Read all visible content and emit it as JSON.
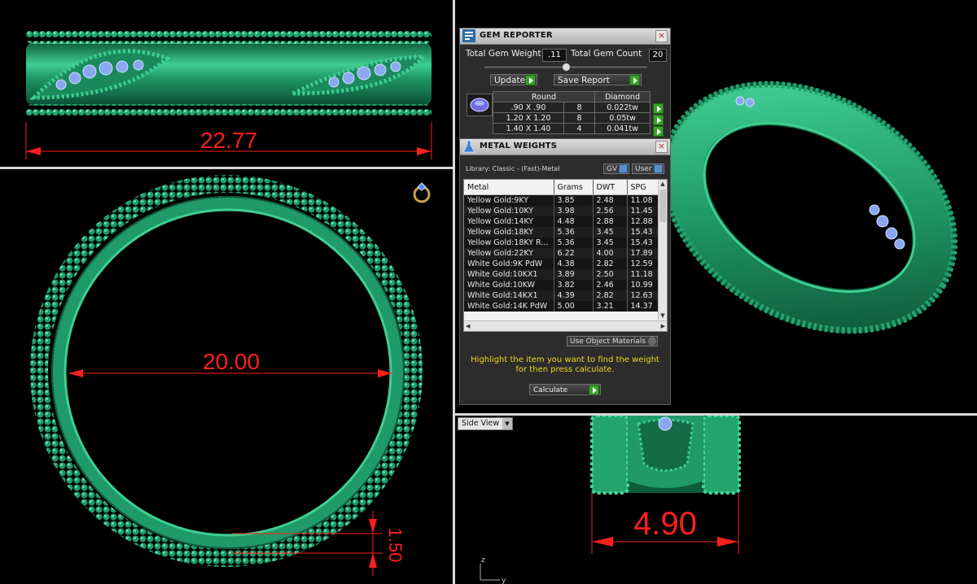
{
  "viewports": {
    "top_left": {
      "dimension": "22.77"
    },
    "bottom_left": {
      "diameter": "20.00",
      "thickness": "1.50"
    },
    "bottom_right": {
      "view_label": "Side View",
      "dimension": "4.90",
      "axis_z": "z",
      "axis_y": "y"
    }
  },
  "gem_reporter": {
    "title": "GEM REPORTER",
    "total_weight_label": "Total Gem Weight",
    "total_weight_value": ".11",
    "total_count_label": "Total Gem Count",
    "total_count_value": "20",
    "update_label": "Update",
    "save_label": "Save Report",
    "table": {
      "headers": [
        "Round",
        "Diamond"
      ],
      "rows": [
        {
          "size": ".90 X .90",
          "count": "8",
          "weight": "0.022tw"
        },
        {
          "size": "1.20 X 1.20",
          "count": "8",
          "weight": "0.05tw"
        },
        {
          "size": "1.40 X 1.40",
          "count": "4",
          "weight": "0.041tw"
        }
      ]
    }
  },
  "metal_weights": {
    "title": "METAL WEIGHTS",
    "library": "Library: Classic - (Fast)-Metal",
    "gv_label": "GV",
    "user_label": "User",
    "columns": [
      "Metal",
      "Grams",
      "DWT",
      "SPG"
    ],
    "rows": [
      [
        "Yellow Gold:9KY",
        "3.85",
        "2.48",
        "11.08"
      ],
      [
        "Yellow Gold:10KY",
        "3.98",
        "2.56",
        "11.45"
      ],
      [
        "Yellow Gold:14KY",
        "4.48",
        "2.88",
        "12.88"
      ],
      [
        "Yellow Gold:18KY",
        "5.36",
        "3.45",
        "15.43"
      ],
      [
        "Yellow Gold:18KY R...",
        "5.36",
        "3.45",
        "15.43"
      ],
      [
        "Yellow Gold:22KY",
        "6.22",
        "4.00",
        "17.89"
      ],
      [
        "White Gold:9K PdW",
        "4.38",
        "2.82",
        "12.59"
      ],
      [
        "White Gold:10KX1",
        "3.89",
        "2.50",
        "11.18"
      ],
      [
        "White Gold:10KW",
        "3.82",
        "2.46",
        "10.99"
      ],
      [
        "White Gold:14KX1",
        "4.39",
        "2.82",
        "12.63"
      ],
      [
        "White Gold:14K PdW",
        "5.00",
        "3.21",
        "14.37"
      ]
    ],
    "use_object_materials": "Use Object Materials",
    "note_line1": "Highlight the item you want to find the weight",
    "note_line2": "for then press calculate.",
    "calculate_label": "Calculate"
  },
  "colors": {
    "ring_green": "#1f9a6a",
    "dimension_red": "#ff1e1e",
    "gem_blue": "#8aa8f0",
    "note_yellow": "#f4d41a"
  }
}
